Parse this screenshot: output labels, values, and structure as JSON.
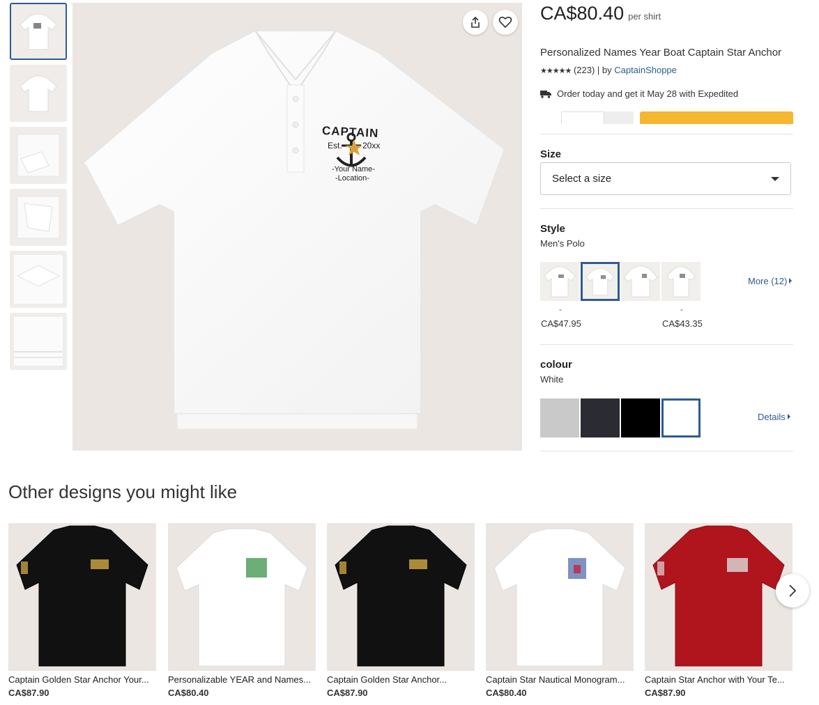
{
  "product": {
    "price": "CA$80.40",
    "price_unit": "per shirt",
    "title": "Personalized Names Year Boat Captain Star Anchor",
    "stars": "★★★★★",
    "review_count": "(223)",
    "by_text": "| by",
    "seller": "CaptainShoppe",
    "delivery_text": "Order today and get it May 28 with Expedited"
  },
  "shirt_print": {
    "line1": "CAPTAIN",
    "est": "Est.",
    "year": "20xx",
    "name": "-Your Name-",
    "location": "-Location-"
  },
  "size": {
    "label": "Size",
    "placeholder": "Select a size"
  },
  "style": {
    "label": "Style",
    "selected": "Men's Polo",
    "options": [
      {
        "dash": "-",
        "price": "CA$47.95"
      },
      {
        "dash": "",
        "price": ""
      },
      {
        "dash": "",
        "price": ""
      },
      {
        "dash": "-",
        "price": "CA$43.35"
      }
    ],
    "more": "More (12)"
  },
  "colour": {
    "label": "colour",
    "selected": "White",
    "swatches": [
      "#c9c9c9",
      "#2a2b33",
      "#000000",
      "#ffffff"
    ],
    "details": "Details"
  },
  "other": {
    "heading": "Other designs you might like",
    "items": [
      {
        "name": "Captain Golden Star Anchor Your...",
        "price": "CA$87.90",
        "shirt": "#111111",
        "ink": "#c8a040"
      },
      {
        "name": "Personalizable YEAR and Names...",
        "price": "CA$80.40",
        "shirt": "#ffffff",
        "ink": "#2e8b3d"
      },
      {
        "name": "Captain Golden Star Anchor...",
        "price": "CA$87.90",
        "shirt": "#111111",
        "ink": "#c8a040"
      },
      {
        "name": "Captain Star Nautical Monogram...",
        "price": "CA$80.40",
        "shirt": "#ffffff",
        "ink": "#2a4a9a"
      },
      {
        "name": "Captain Star Anchor with Your Te...",
        "price": "CA$87.90",
        "shirt": "#b0141c",
        "ink": "#dddddd"
      }
    ]
  },
  "colors": {
    "accent": "#2f5b8f",
    "cart": "#f5b630"
  }
}
